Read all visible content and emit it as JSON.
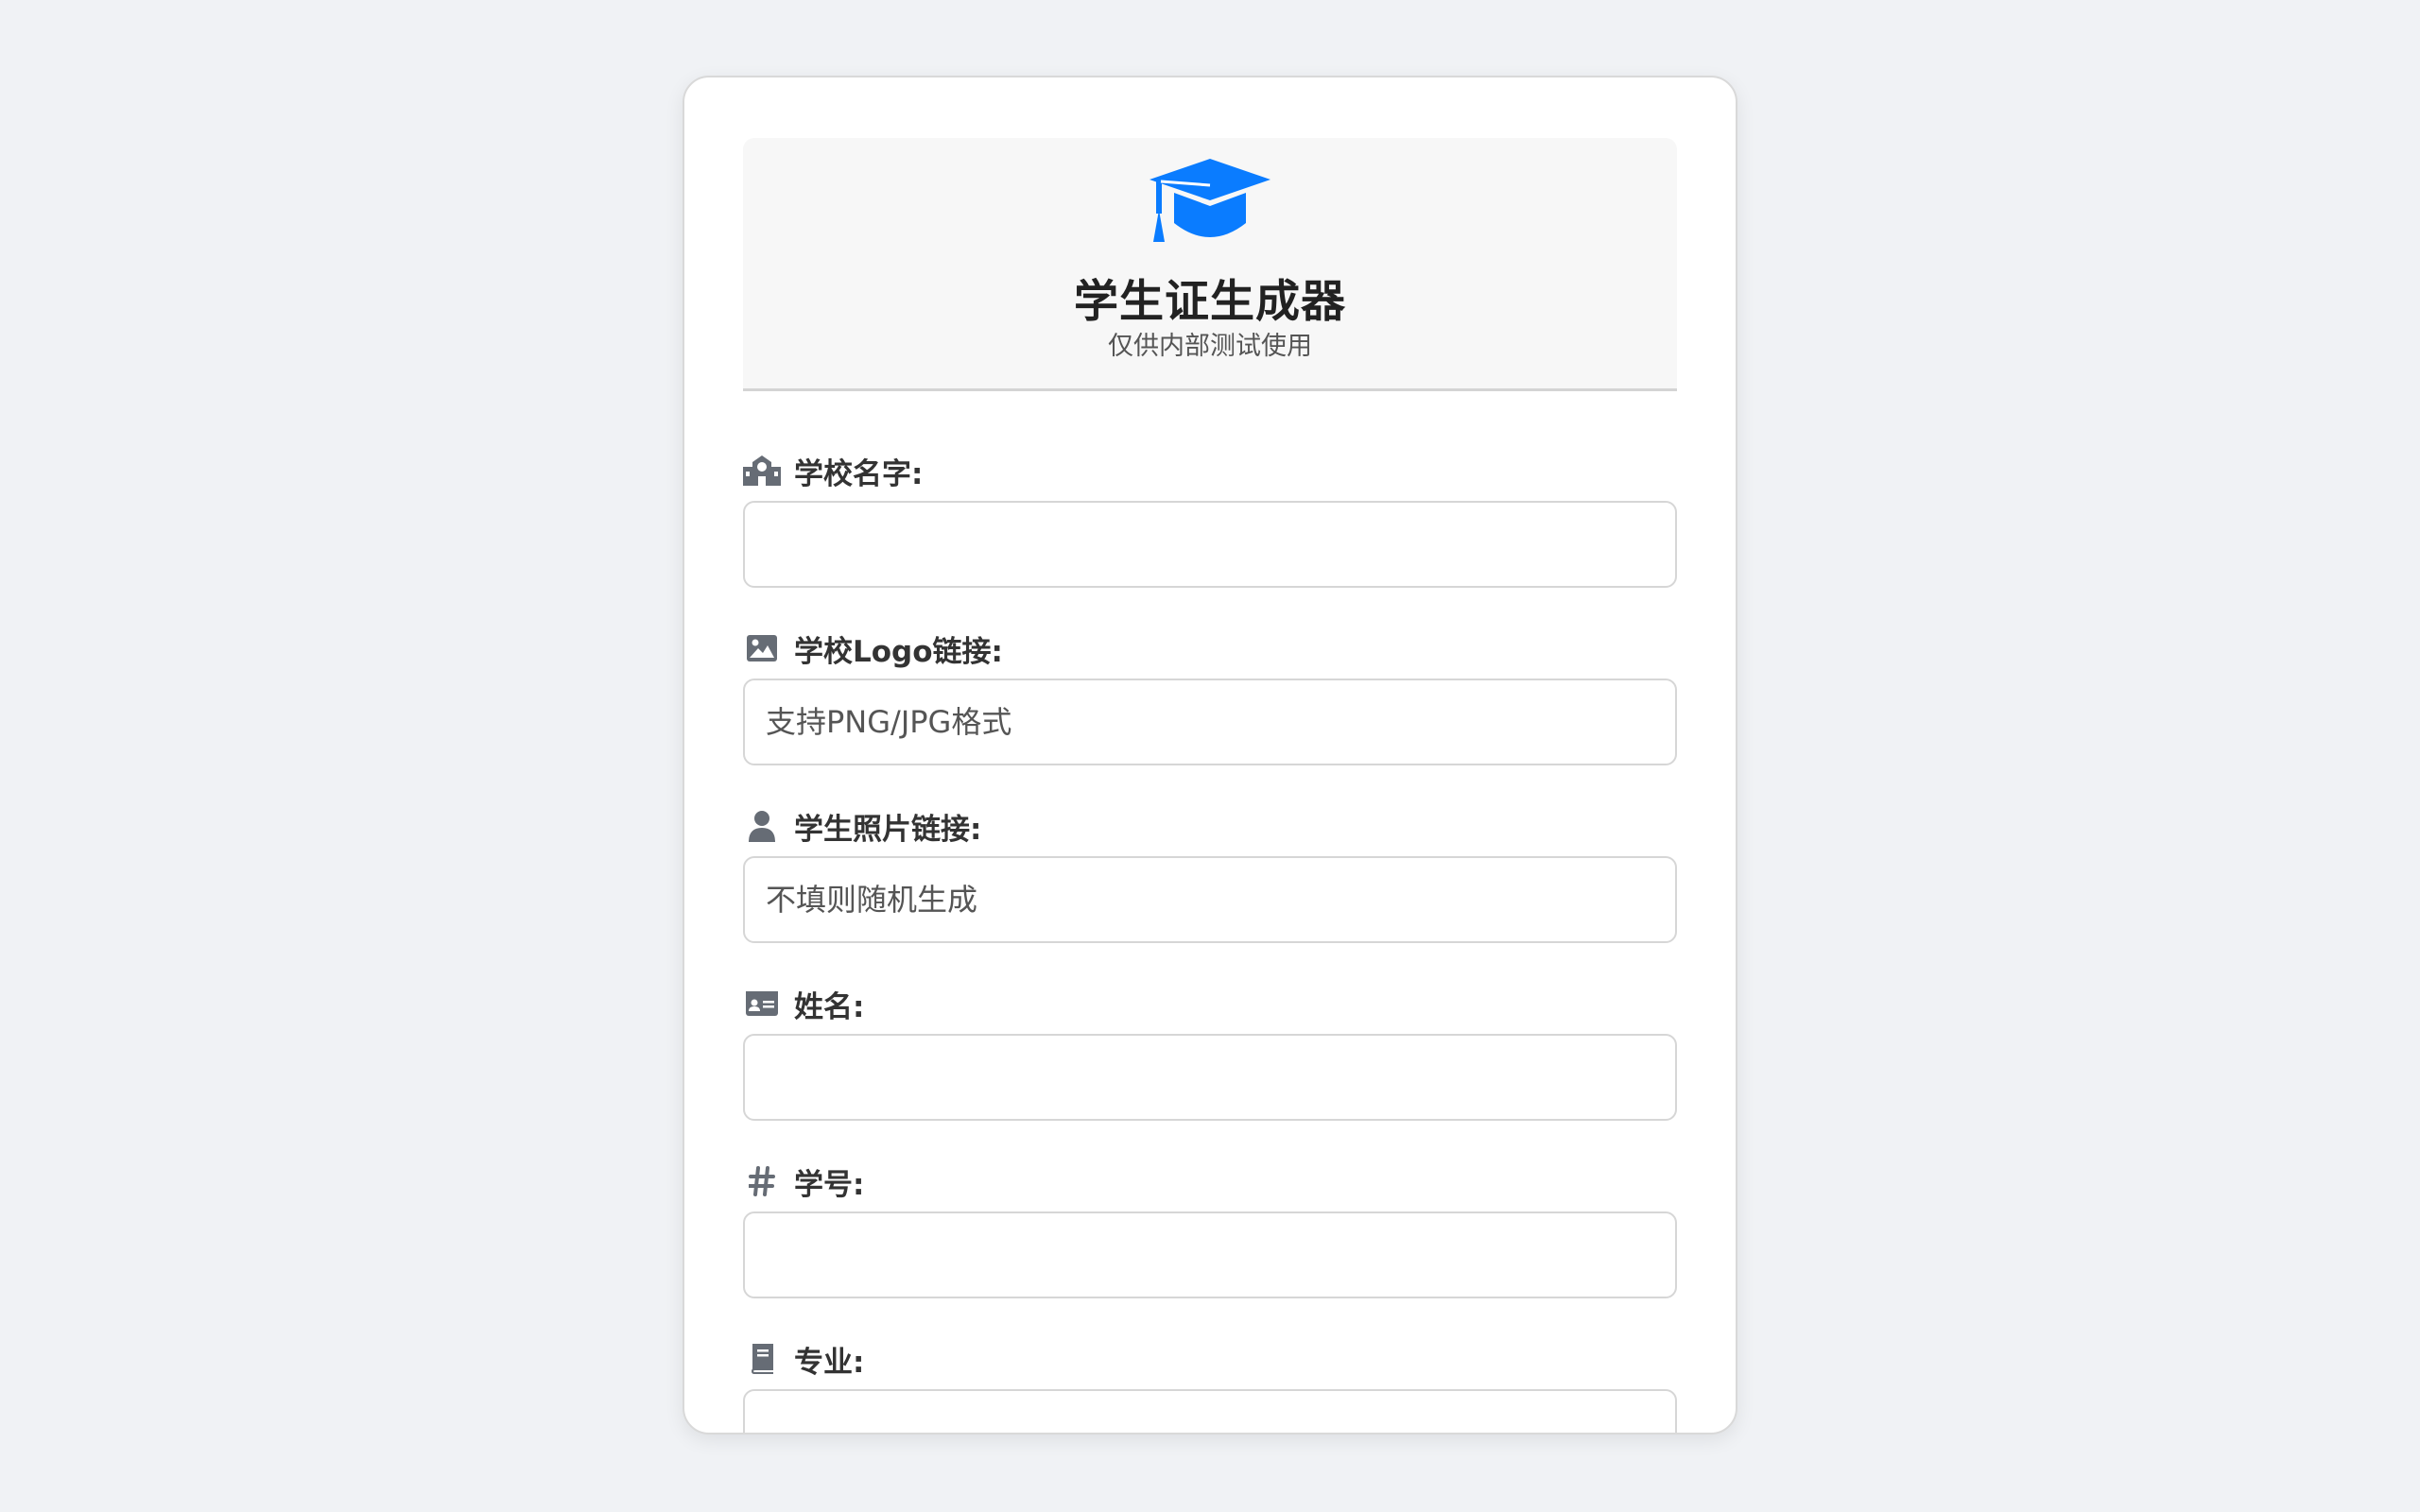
{
  "header": {
    "title": "学生证生成器",
    "subtitle": "仅供内部测试使用"
  },
  "colors": {
    "accent": "#0a7cff",
    "icon_gray": "#666c75"
  },
  "form": {
    "fields": [
      {
        "icon": "school-icon",
        "label": "学校名字:",
        "placeholder": "",
        "value": ""
      },
      {
        "icon": "image-icon",
        "label": "学校Logo链接:",
        "placeholder": "支持PNG/JPG格式",
        "value": ""
      },
      {
        "icon": "user-icon",
        "label": "学生照片链接:",
        "placeholder": "不填则随机生成",
        "value": ""
      },
      {
        "icon": "id-card-icon",
        "label": "姓名:",
        "placeholder": "",
        "value": ""
      },
      {
        "icon": "hashtag-icon",
        "label": "学号:",
        "placeholder": "",
        "value": ""
      },
      {
        "icon": "book-icon",
        "label": "专业:",
        "placeholder": "",
        "value": ""
      }
    ]
  }
}
